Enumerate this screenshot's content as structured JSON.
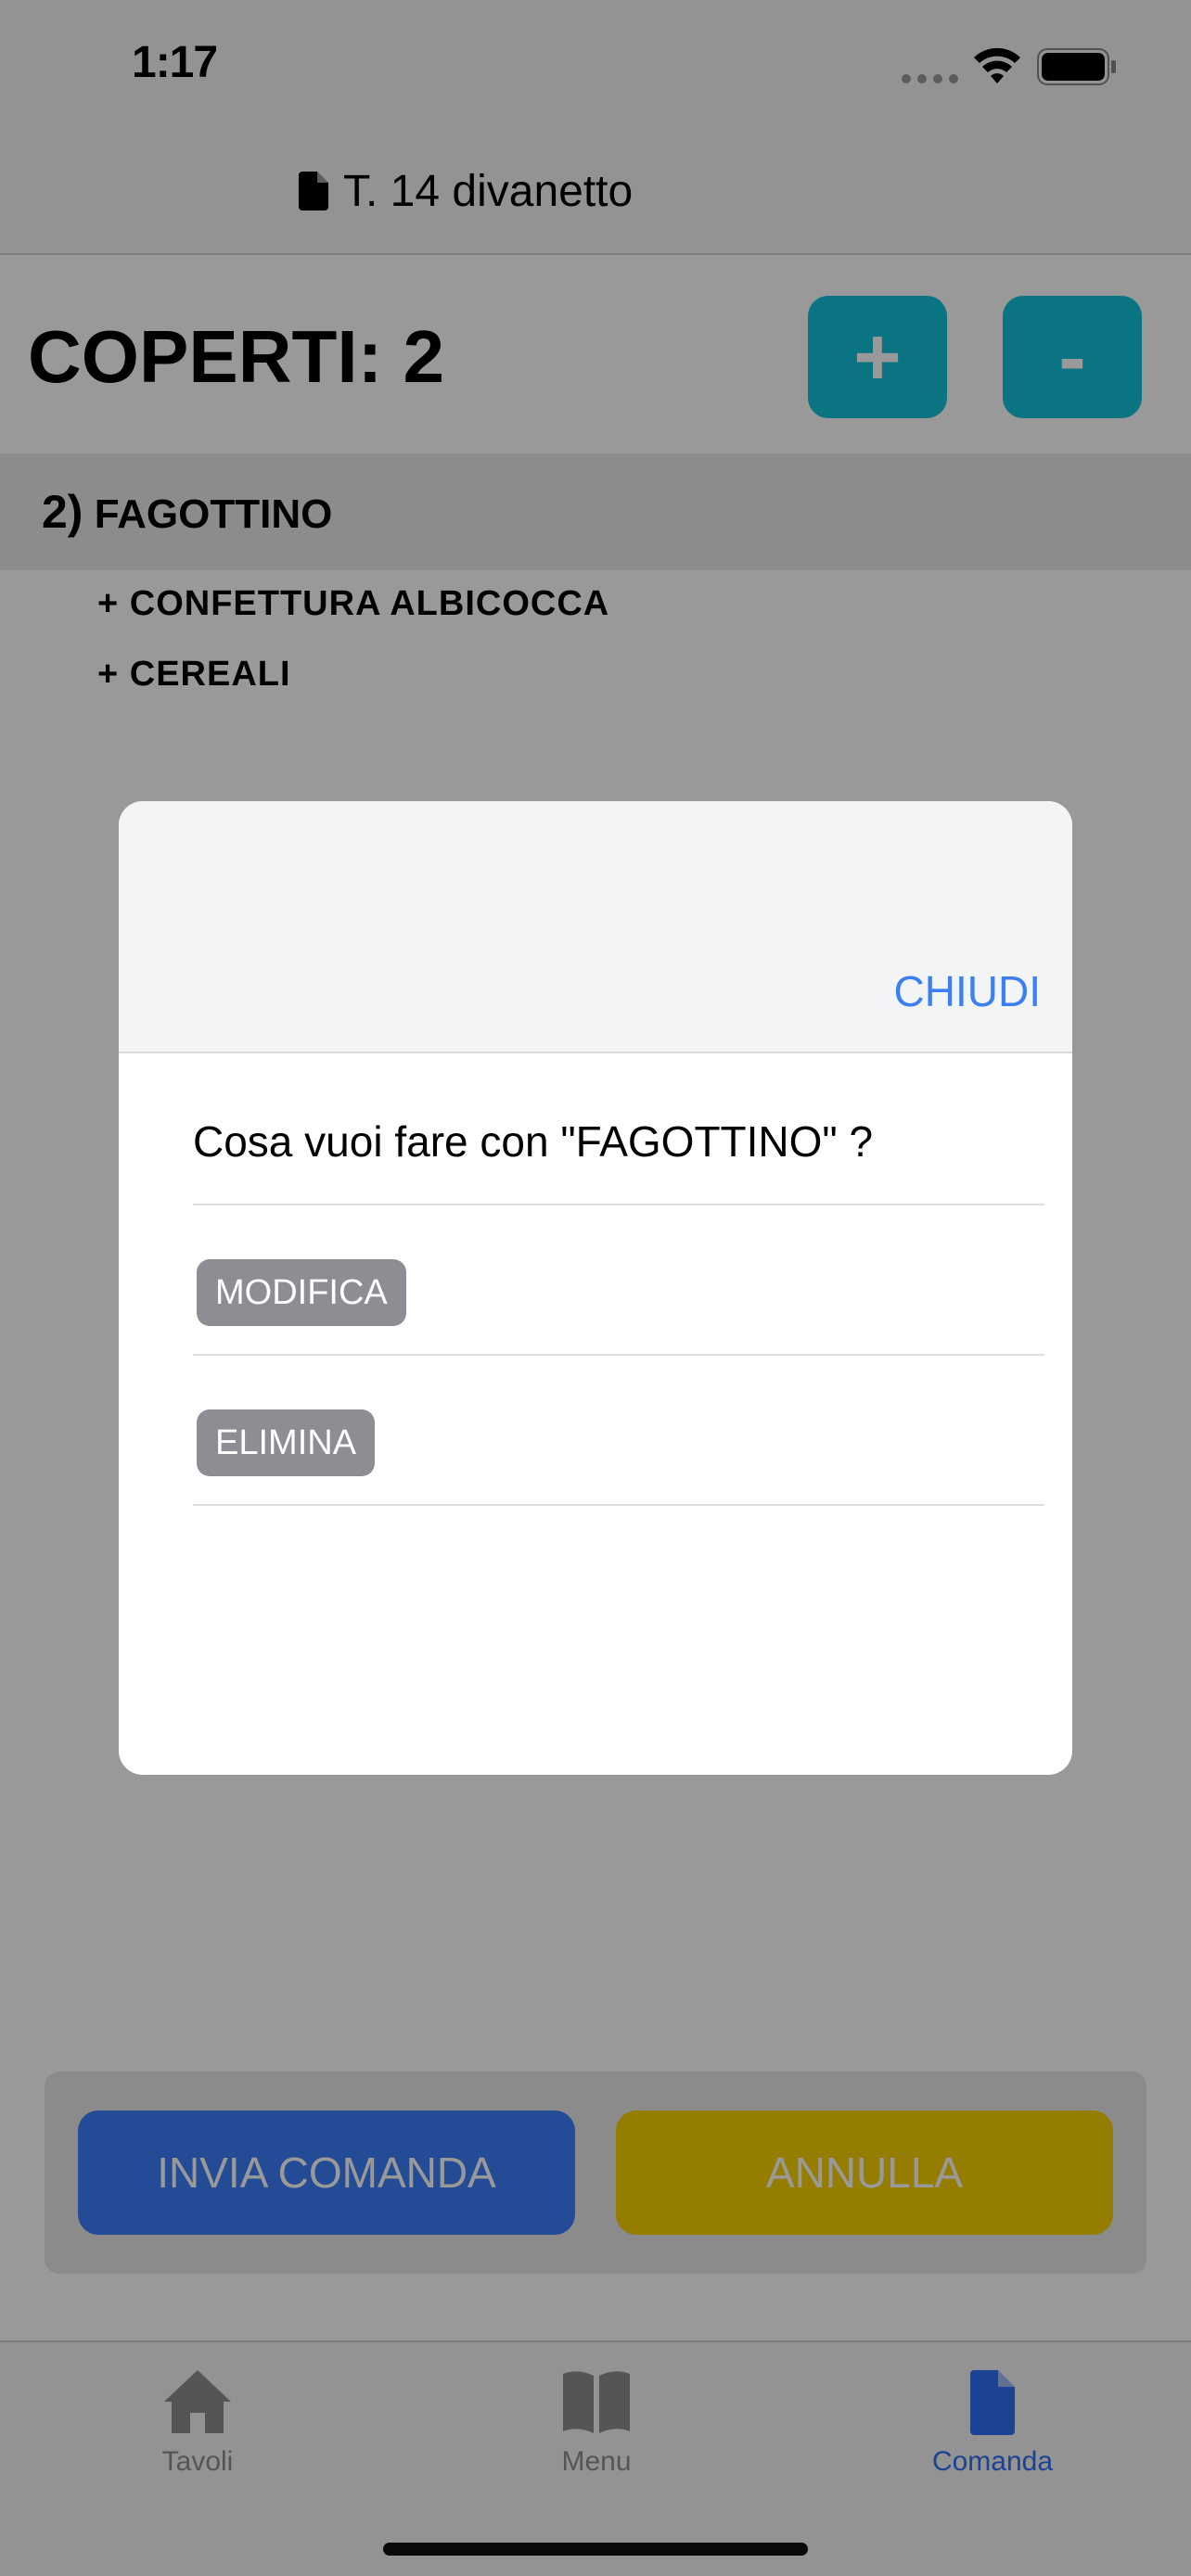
{
  "status_bar": {
    "time": "1:17"
  },
  "nav": {
    "title": "T. 14 divanetto",
    "title_icon": "document-icon"
  },
  "coperti": {
    "label": "COPERTI: 2",
    "plus_label": "+",
    "minus_label": "-",
    "button_color": "#11c1db"
  },
  "order": {
    "item_number": "2)",
    "item_name": "FAGOTTINO",
    "addons": [
      "+ CONFETTURA ALBICOCCA",
      "+ CEREALI"
    ]
  },
  "actions": {
    "send_label": "INVIA COMANDA",
    "send_color": "#3d7ef8",
    "cancel_label": "ANNULLA",
    "cancel_color": "#f8d100"
  },
  "tab_bar": {
    "tabs": [
      {
        "label": "Tavoli",
        "icon": "house-icon",
        "active": false
      },
      {
        "label": "Menu",
        "icon": "book-icon",
        "active": false
      },
      {
        "label": "Comanda",
        "icon": "document-icon",
        "active": true
      }
    ],
    "active_color": "#2f6ef6"
  },
  "modal": {
    "close_label": "CHIUDI",
    "question": "Cosa vuoi fare con \"FAGOTTINO\" ?",
    "options": [
      "MODIFICA",
      "ELIMINA"
    ]
  }
}
